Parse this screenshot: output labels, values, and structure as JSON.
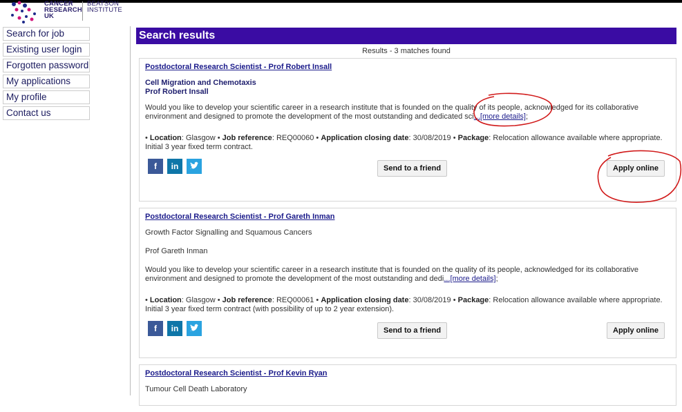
{
  "logo": {
    "line1": "CANCER RESEARCH UK",
    "line2": "BEATSON INSTITUTE"
  },
  "sidebar": {
    "items": [
      {
        "label": "Search for job"
      },
      {
        "label": "Existing user login"
      },
      {
        "label": "Forgotten password"
      },
      {
        "label": "My applications"
      },
      {
        "label": "My profile"
      },
      {
        "label": "Contact us"
      }
    ]
  },
  "results": {
    "heading": "Search results",
    "count_text": "Results - 3 matches found"
  },
  "jobs": [
    {
      "title": "Postdoctoral Research Scientist - Prof Robert Insall",
      "subtitle": "Cell Migration and Chemotaxis",
      "supervisor": "Prof Robert Insall",
      "description": "Would you like to develop your scientific career in a research institute that is founded on the quality of its people, acknowledged for its collaborative environment and designed to promote the development of the most outstanding and dedicated sci",
      "more_link": "...[more details]",
      "location_label": "Location",
      "location": "Glasgow",
      "ref_label": "Job reference",
      "ref": "REQ00060",
      "closing_label": "Application closing date",
      "closing": "30/08/2019",
      "package_label": "Package",
      "package": "Relocation allowance available where appropriate. Initial 3 year fixed term contract.",
      "send_label": "Send to a friend",
      "apply_label": "Apply online"
    },
    {
      "title": "Postdoctoral Research Scientist - Prof Gareth Inman",
      "subtitle": "Growth Factor Signalling and Squamous Cancers",
      "supervisor": "Prof Gareth Inman",
      "description": "Would you like to develop your scientific career in a research institute that is founded on the quality of its people, acknowledged for its collaborative environment and designed to promote the development of the most outstanding and dedi",
      "more_link": "...[more details]",
      "location_label": "Location",
      "location": "Glasgow",
      "ref_label": "Job reference",
      "ref": "REQ00061",
      "closing_label": "Application closing date",
      "closing": "30/08/2019",
      "package_label": "Package",
      "package": "Relocation allowance available where appropriate. Initial 3 year fixed term contract (with possibility of up to 2 year extension).",
      "send_label": "Send to a friend",
      "apply_label": "Apply online"
    },
    {
      "title": "Postdoctoral Research Scientist - Prof Kevin Ryan",
      "subtitle": "Tumour Cell Death Laboratory"
    }
  ],
  "social": {
    "facebook": "f",
    "linkedin": "in",
    "twitter": "✓"
  },
  "colors": {
    "header_bg": "#3a0ca3",
    "link": "#1a1a8a",
    "annotation": "#d11a1a"
  }
}
